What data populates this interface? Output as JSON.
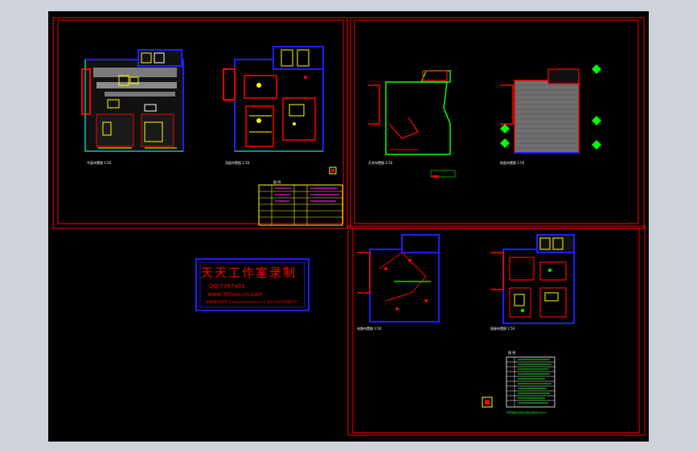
{
  "viewport": {
    "background": "#000000",
    "app_background": "#cdd3d9"
  },
  "colors": {
    "frame": "#ff0000",
    "wall": "#1e1eff",
    "green": "#00ff00",
    "yellow": "#ffff00",
    "white": "#ffffff",
    "gray": "#9a9a9a",
    "magenta": "#ff00ff"
  },
  "sheets": [
    {
      "id": "sheet-top-left",
      "plan_labels": [
        "平面布置图 1:50",
        "顶面布置图 1:50"
      ],
      "legend_title": "图 例"
    },
    {
      "id": "sheet-top-right",
      "plan_labels": [
        "开关布置图 1:50",
        "地面布置图 1:50"
      ]
    },
    {
      "id": "sheet-bottom-right",
      "plan_labels": [
        "电路布置图 1:50",
        "插座布置图 1:50"
      ],
      "legend_title": "图 例",
      "note": "所有插座高度除注明外均距地300mm"
    }
  ],
  "watermark": {
    "title": "天天工作室录制",
    "qq": "QQ:7397401",
    "url": "www.3ttsuo.cn.com",
    "footer": "本图纸仅供学习 www.ttcad.com.cn  QQ:1397388979"
  }
}
